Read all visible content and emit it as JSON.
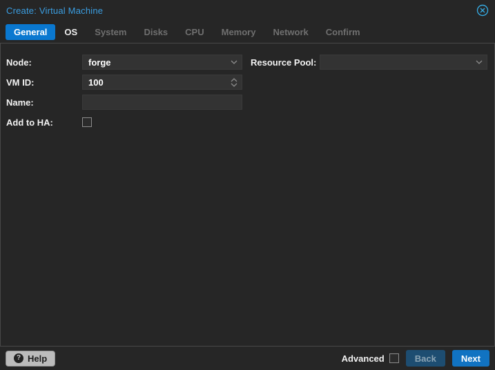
{
  "window": {
    "title": "Create: Virtual Machine"
  },
  "tabs": [
    {
      "label": "General",
      "state": "active"
    },
    {
      "label": "OS",
      "state": "enabled"
    },
    {
      "label": "System",
      "state": "disabled"
    },
    {
      "label": "Disks",
      "state": "disabled"
    },
    {
      "label": "CPU",
      "state": "disabled"
    },
    {
      "label": "Memory",
      "state": "disabled"
    },
    {
      "label": "Network",
      "state": "disabled"
    },
    {
      "label": "Confirm",
      "state": "disabled"
    }
  ],
  "form": {
    "node": {
      "label": "Node:",
      "value": "forge"
    },
    "vmid": {
      "label": "VM ID:",
      "value": "100"
    },
    "name": {
      "label": "Name:",
      "value": ""
    },
    "ha": {
      "label": "Add to HA:",
      "checked": false
    },
    "pool": {
      "label": "Resource Pool:",
      "value": ""
    }
  },
  "footer": {
    "help_label": "Help",
    "help_icon": "?",
    "advanced_label": "Advanced",
    "advanced_checked": false,
    "back_label": "Back",
    "next_label": "Next"
  },
  "colors": {
    "window_bg": "#262626",
    "field_bg": "#333333",
    "accent_tab": "#0a78d0",
    "title_text": "#3b9fe3",
    "close_icon": "#35a9e0",
    "next_button": "#1173c2",
    "back_button": "#1d4d71",
    "help_button": "#bcbcbc",
    "panel_border": "#484848"
  }
}
